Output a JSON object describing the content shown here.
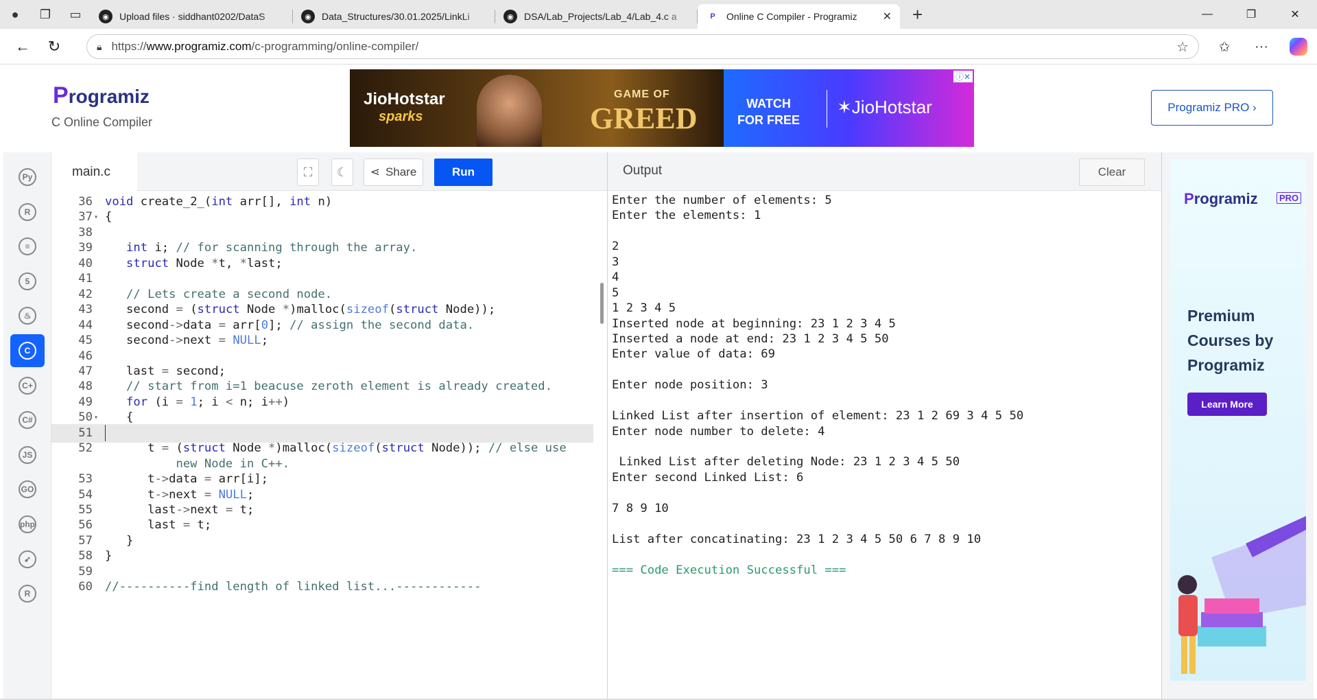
{
  "browser": {
    "tabs": [
      {
        "title": "Upload files · siddhant0202/DataS",
        "favicon": "github-icon"
      },
      {
        "title": "Data_Structures/30.01.2025/LinkLi",
        "favicon": "github-icon"
      },
      {
        "title": "DSA/Lab_Projects/Lab_4/Lab_4.c a",
        "favicon": "github-icon"
      },
      {
        "title": "Online C Compiler - Programiz",
        "favicon": "programiz-icon",
        "active": true
      }
    ],
    "url_scheme": "https://",
    "url_host": "www.programiz.com",
    "url_path": "/c-programming/online-compiler/"
  },
  "header": {
    "logo_text": "rogramiz",
    "logo_letter": "P",
    "subtitle": "C Online Compiler",
    "pro_button": "Programiz PRO ›"
  },
  "banner": {
    "brand": "JioHotstar",
    "brand_sub": "sparks",
    "show_top": "GAME OF",
    "show_bottom": "GREED",
    "cta_line1": "WATCH",
    "cta_line2": "FOR FREE",
    "logo": "JioHotstar"
  },
  "editor": {
    "filename": "main.c",
    "share_label": "Share",
    "run_label": "Run",
    "lines": [
      {
        "n": "36",
        "fold": false,
        "html": "<span class=\"kw\">void</span> create_2_(<span class=\"kw\">int</span> arr[], <span class=\"kw\">int</span> n)"
      },
      {
        "n": "37",
        "fold": true,
        "html": "{"
      },
      {
        "n": "38",
        "fold": false,
        "html": ""
      },
      {
        "n": "39",
        "fold": false,
        "html": "   <span class=\"kw\">int</span> i; <span class=\"cm\">// for scanning through the array.</span>"
      },
      {
        "n": "40",
        "fold": false,
        "html": "   <span class=\"kw\">struct</span> Node <span class=\"op\">*</span>t, <span class=\"op\">*</span>last;"
      },
      {
        "n": "41",
        "fold": false,
        "html": ""
      },
      {
        "n": "42",
        "fold": false,
        "html": "   <span class=\"cm\">// Lets create a second node.</span>"
      },
      {
        "n": "43",
        "fold": false,
        "html": "   second <span class=\"op\">=</span> (<span class=\"kw\">struct</span> Node <span class=\"op\">*</span>)malloc(<span class=\"lit\">sizeof</span>(<span class=\"kw\">struct</span> Node));"
      },
      {
        "n": "44",
        "fold": false,
        "html": "   second<span class=\"op\">-></span>data <span class=\"op\">=</span> arr[<span class=\"lit\">0</span>]; <span class=\"cm\">// assign the second data.</span>"
      },
      {
        "n": "45",
        "fold": false,
        "html": "   second<span class=\"op\">-></span>next <span class=\"op\">=</span> <span class=\"lit\">NULL</span>;"
      },
      {
        "n": "46",
        "fold": false,
        "html": ""
      },
      {
        "n": "47",
        "fold": false,
        "html": "   last <span class=\"op\">=</span> second;"
      },
      {
        "n": "48",
        "fold": false,
        "html": "   <span class=\"cm\">// start from i=1 beacuse zeroth element is already created.</span>"
      },
      {
        "n": "49",
        "fold": false,
        "html": "   <span class=\"kw\">for</span> (i <span class=\"op\">=</span> <span class=\"lit\">1</span>; i <span class=\"op\"><</span> n; i<span class=\"op\">++</span>)"
      },
      {
        "n": "50",
        "fold": true,
        "html": "   {"
      },
      {
        "n": "51",
        "fold": false,
        "html": "",
        "highlight": true
      },
      {
        "n": "52",
        "fold": false,
        "html": "      t <span class=\"op\">=</span> (<span class=\"kw\">struct</span> Node <span class=\"op\">*</span>)malloc(<span class=\"lit\">sizeof</span>(<span class=\"kw\">struct</span> Node)); <span class=\"cm\">// else use</span>"
      },
      {
        "n": "",
        "fold": false,
        "html": "          <span class=\"cm\">new Node in C++.</span>"
      },
      {
        "n": "53",
        "fold": false,
        "html": "      t<span class=\"op\">-></span>data <span class=\"op\">=</span> arr[i];"
      },
      {
        "n": "54",
        "fold": false,
        "html": "      t<span class=\"op\">-></span>next <span class=\"op\">=</span> <span class=\"lit\">NULL</span>;"
      },
      {
        "n": "55",
        "fold": false,
        "html": "      last<span class=\"op\">-></span>next <span class=\"op\">=</span> t;"
      },
      {
        "n": "56",
        "fold": false,
        "html": "      last <span class=\"op\">=</span> t;"
      },
      {
        "n": "57",
        "fold": false,
        "html": "   }"
      },
      {
        "n": "58",
        "fold": false,
        "html": "}"
      },
      {
        "n": "59",
        "fold": false,
        "html": ""
      },
      {
        "n": "60",
        "fold": false,
        "html": "<span class=\"cm\">//----------find length of linked list...------------</span>"
      }
    ]
  },
  "output": {
    "title": "Output",
    "clear_label": "Clear",
    "lines": [
      "Enter the number of elements: 5",
      "Enter the elements: 1",
      "",
      "2",
      "3",
      "4",
      "5",
      "1 2 3 4 5",
      "Inserted node at beginning: 23 1 2 3 4 5",
      "Inserted a node at end: 23 1 2 3 4 5 50",
      "Enter value of data: 69",
      "",
      "Enter node position: 3",
      "",
      "Linked List after insertion of element: 23 1 2 69 3 4 5 50",
      "Enter node number to delete: 4",
      "",
      " Linked List after deleting Node: 23 1 2 3 4 5 50",
      "Enter second Linked List: 6",
      "",
      "7 8 9 10",
      "",
      "List after concatinating: 23 1 2 3 4 5 50 6 7 8 9 10",
      ""
    ],
    "success": "=== Code Execution Successful ==="
  },
  "sidebar_langs": [
    {
      "name": "python-icon",
      "label": "Py"
    },
    {
      "name": "r-icon",
      "label": "R"
    },
    {
      "name": "sql-icon",
      "label": "≡"
    },
    {
      "name": "html-icon",
      "label": "5"
    },
    {
      "name": "java-icon",
      "label": "♨"
    },
    {
      "name": "c-icon",
      "label": "C",
      "active": true
    },
    {
      "name": "cpp-icon",
      "label": "C+"
    },
    {
      "name": "csharp-icon",
      "label": "C#"
    },
    {
      "name": "js-icon",
      "label": "JS"
    },
    {
      "name": "go-icon",
      "label": "GO"
    },
    {
      "name": "php-icon",
      "label": "php"
    },
    {
      "name": "swift-icon",
      "label": "➶"
    },
    {
      "name": "rust-icon",
      "label": "R"
    }
  ],
  "ad": {
    "logo": "rogramiz",
    "logo_letter": "P",
    "pro": "PRO",
    "heading": "Premium Courses by Programiz",
    "button": "Learn More"
  }
}
